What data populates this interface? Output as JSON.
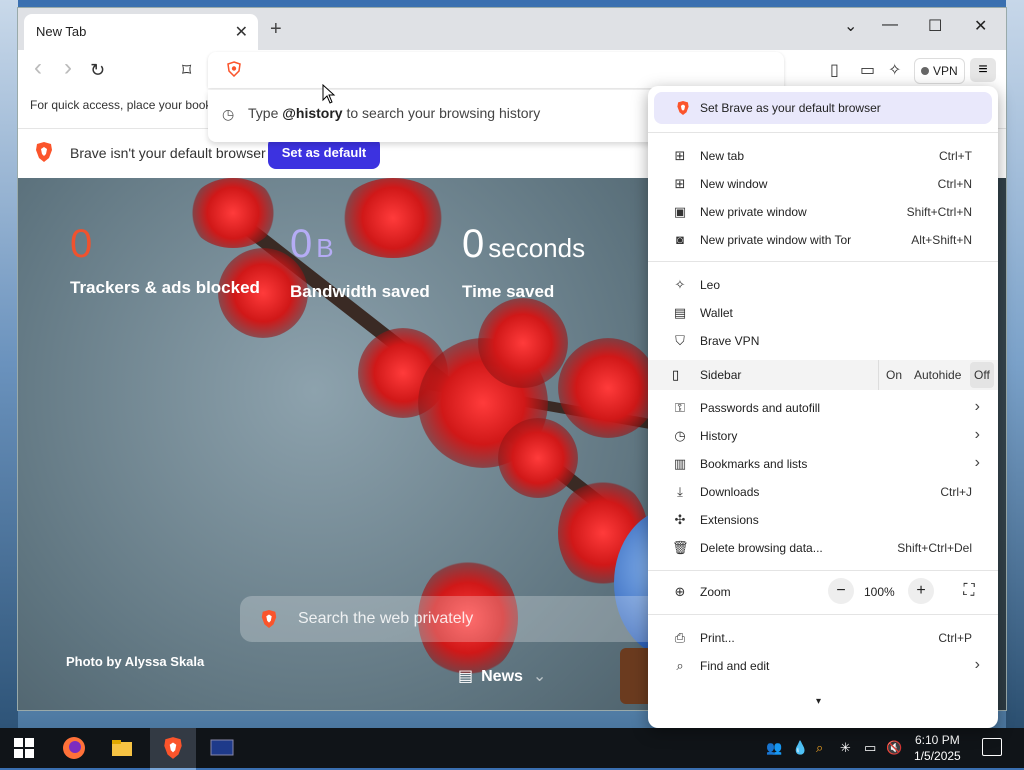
{
  "browser": {
    "tab_title": "New Tab",
    "tab_close": "✕",
    "new_tab": "+",
    "win_controls": [
      "⌄",
      "—",
      "☐",
      "✕"
    ]
  },
  "toolbar": {
    "back": "‹",
    "forward": "›",
    "reload": "↻",
    "bookmark": "⌑",
    "vpn_label": "VPN",
    "menu_glyph": "≡",
    "icons": [
      "sidebar-icon",
      "wallet-icon",
      "leo-icon"
    ]
  },
  "history_dropdown": {
    "prefix": "Type ",
    "keyword": "@history",
    "suffix": " to search your browsing history"
  },
  "bookmarks_hint": "For quick access, place your book",
  "default_bar": {
    "message": "Brave isn't your default browser",
    "button": "Set as default"
  },
  "ntp": {
    "stats": [
      {
        "value": "0",
        "unit": "",
        "label": "Trackers & ads blocked",
        "color": "#f0522e"
      },
      {
        "value": "0",
        "unit": "B",
        "label": "Bandwidth saved",
        "color": "#b5acf5"
      },
      {
        "value": "0",
        "unit": "seconds",
        "label": "Time saved",
        "color": "#ffffff"
      }
    ],
    "search_placeholder": "Search the web privately",
    "photo_credit": "Photo by Alyssa Skala",
    "news_label": "News"
  },
  "menu": {
    "top_item": "Set Brave as your default browser",
    "group1": [
      {
        "label": "New tab",
        "shortcut": "Ctrl+T",
        "icon": "new-tab-icon",
        "glyph": "⊞"
      },
      {
        "label": "New window",
        "shortcut": "Ctrl+N",
        "icon": "new-window-icon",
        "glyph": "⊞"
      },
      {
        "label": "New private window",
        "shortcut": "Shift+Ctrl+N",
        "icon": "private-window-icon",
        "glyph": "▣"
      },
      {
        "label": "New private window with Tor",
        "shortcut": "Alt+Shift+N",
        "icon": "tor-window-icon",
        "glyph": "◙"
      }
    ],
    "group2": [
      {
        "label": "Leo",
        "icon": "leo-icon",
        "glyph": "✧"
      },
      {
        "label": "Wallet",
        "icon": "wallet-icon",
        "glyph": "▤"
      },
      {
        "label": "Brave VPN",
        "icon": "vpn-icon",
        "glyph": "⛉"
      }
    ],
    "sidebar": {
      "label": "Sidebar",
      "options": [
        "On",
        "Autohide",
        "Off"
      ],
      "selected": "Off"
    },
    "group3": [
      {
        "label": "Passwords and autofill",
        "icon": "key-icon",
        "glyph": "⚿"
      },
      {
        "label": "History",
        "icon": "history-icon",
        "glyph": "◷"
      },
      {
        "label": "Bookmarks and lists",
        "icon": "bookmarks-icon",
        "glyph": "▥"
      }
    ],
    "group4": [
      {
        "label": "Downloads",
        "shortcut": "Ctrl+J",
        "icon": "download-icon",
        "glyph": "⤓"
      },
      {
        "label": "Extensions",
        "icon": "extensions-icon",
        "glyph": "✣"
      },
      {
        "label": "Delete browsing data...",
        "shortcut": "Shift+Ctrl+Del",
        "icon": "trash-icon",
        "glyph": "🗑"
      }
    ],
    "zoom": {
      "label": "Zoom",
      "value": "100%",
      "minus": "−",
      "plus": "+",
      "fullscreen": "⛶"
    },
    "group5": [
      {
        "label": "Print...",
        "shortcut": "Ctrl+P",
        "icon": "print-icon",
        "glyph": "⎙"
      },
      {
        "label": "Find and edit",
        "icon": "find-icon",
        "glyph": "⌕"
      }
    ],
    "scroll_arrow": "▾"
  },
  "taskbar": {
    "time": "6:10 PM",
    "date": "1/5/2025"
  },
  "colors": {
    "brave_orange": "#fb542b",
    "set_default_blue": "#3c32e0"
  }
}
